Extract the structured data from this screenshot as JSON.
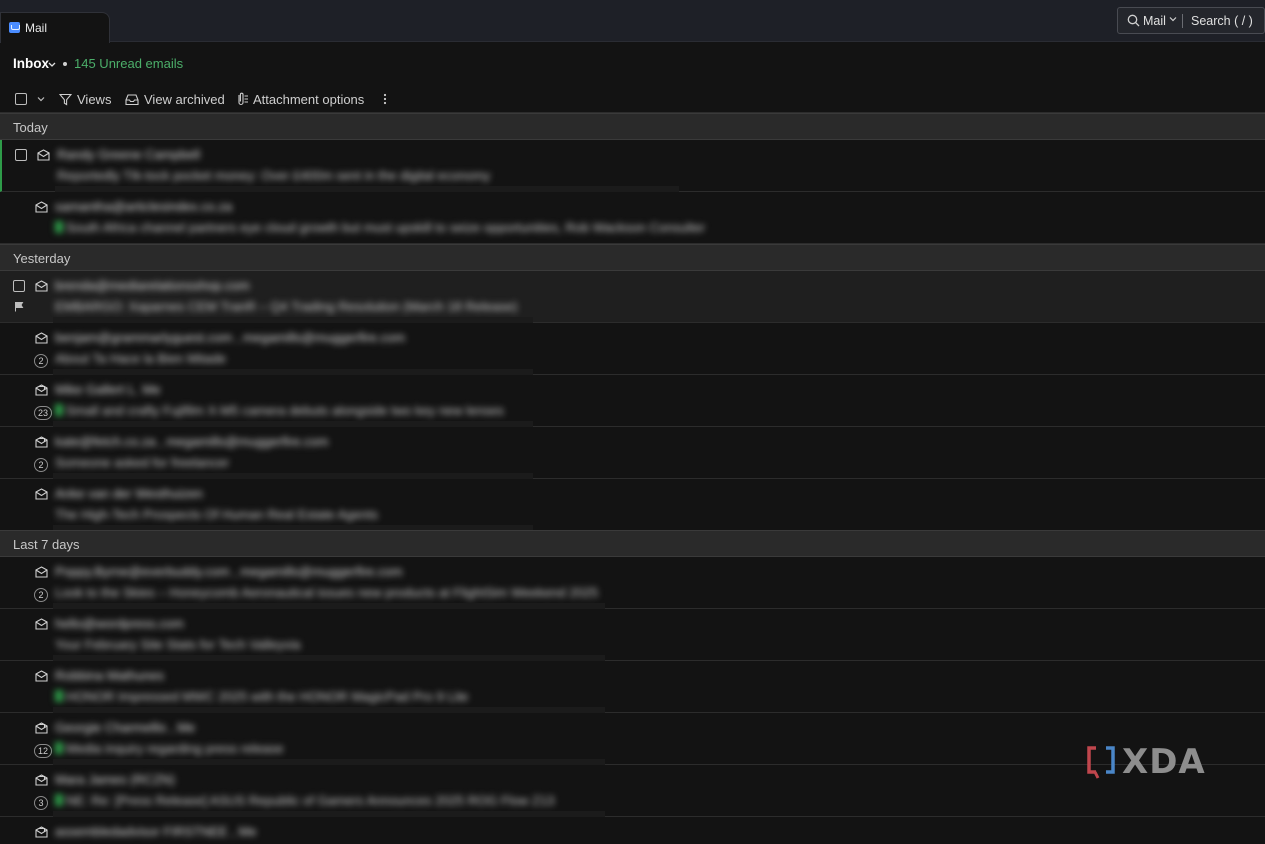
{
  "app": {
    "tab_label": "Mail"
  },
  "search": {
    "scope": "Mail",
    "placeholder": "Search ( / )"
  },
  "folder": {
    "title": "Inbox",
    "unread_text": "145 Unread emails"
  },
  "toolbar": {
    "views_label": "Views",
    "archived_label": "View archived",
    "attachment_label": "Attachment options"
  },
  "sections": [
    {
      "label": "Today"
    },
    {
      "label": "Yesterday"
    },
    {
      "label": "Last 7 days"
    }
  ],
  "emails": [
    {
      "sender": "Randy Greene Campbell",
      "subject": "Reportedly TIk-tock pocket money: Over £400m sent in the digital economy",
      "count": "",
      "tag": false,
      "read": false
    },
    {
      "sender": "samantha@articlesindex.co.za",
      "subject": "South Africa channel partners eye cloud growth but must upskill to seize opportunities, Rob Wackson Consulter",
      "count": "",
      "tag": true,
      "read": false
    },
    {
      "sender": "brenda@mediarelationsshop.com",
      "subject": "EMBARGO: Xaparnes CEM TranR – Q4 Trading Resolution (March 18 Release)",
      "count": "",
      "tag": false,
      "read": false
    },
    {
      "sender": "benjam@grammarlyguest.com , megamills@muggerfire.com",
      "subject": "About Ta Hace la Bien Mitade",
      "count": "2",
      "tag": false,
      "read": false
    },
    {
      "sender": "Mike Gallert L. Me",
      "subject": "Small and crafty Fujifilm X-M5 camera debuts alongside two key new lenses",
      "count": "23",
      "tag": true,
      "read": true
    },
    {
      "sender": "kate@fetch.co.za , megamills@muggerfire.com",
      "subject": "Someone asked for freelancer",
      "count": "2",
      "tag": false,
      "read": true
    },
    {
      "sender": "Anke van der Westhuizen",
      "subject": "The High-Tech Prospects Of Human Real Estate Agents",
      "count": "",
      "tag": false,
      "read": false
    },
    {
      "sender": "Poppy.Byrne@everbuddy.com , megamills@muggerfire.com",
      "subject": "Look to the Skies – Honeycomb Aeronautical issues new products at FlightSim Weekend 2025",
      "count": "2",
      "tag": false,
      "read": false
    },
    {
      "sender": "hello@wordpress.com",
      "subject": "Your February Site Stats for Tech Valleyvia",
      "count": "",
      "tag": false,
      "read": false
    },
    {
      "sender": "Robbina Mathunes",
      "subject": "HONOR Impressed MWC 2025 with the HONOR MagicPad Pro 9 Lite",
      "count": "",
      "tag": true,
      "read": false
    },
    {
      "sender": "Georgie Charmellis , Me",
      "subject": "Media inquiry regarding press release",
      "count": "12",
      "tag": true,
      "read": true
    },
    {
      "sender": "Mara James (RCZN)",
      "subject": "NE: Re: [Press Release] ASUS Republic of Gamers Announces 2025 ROG Flow Z13",
      "count": "3",
      "tag": true,
      "read": true
    },
    {
      "sender": "assembledadvisor FIRSTNEE , Me",
      "subject": "",
      "count": "",
      "tag": false,
      "read": true
    }
  ],
  "watermark": {
    "text": "XDA"
  }
}
